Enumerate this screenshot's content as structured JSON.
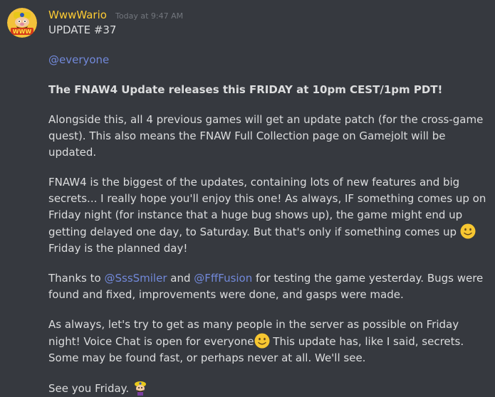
{
  "message": {
    "author": "WwwWario",
    "timestamp": "Today at 9:47 AM",
    "title": "UPDATE #37",
    "mention_everyone": "@everyone",
    "headline": "The FNAW4 Update releases this FRIDAY at 10pm CEST/1pm PDT!",
    "para1": "Alongside this, all 4 previous games will get an update patch (for the cross-game quest). This also means the FNAW Full Collection page on Gamejolt will be updated.",
    "para2_a": "FNAW4 is the biggest of the updates, containing lots of new features and big secrets... I really hope you'll enjoy this one! As always, IF something comes up on Friday night (for instance that a huge bug shows up), the game might end up getting delayed one day, to Saturday. But that's only if something comes up",
    "para2_b": "Friday is the planned day!",
    "para3_a": "Thanks to",
    "mention_1": "@SssSmiler",
    "para3_b": "and",
    "mention_2": "@FffFusion",
    "para3_c": "for testing the game yesterday. Bugs were found and fixed, improvements were done, and gasps were made.",
    "para4_a": "As always, let's try to get as many people in the server as possible on Friday night! Voice Chat is open for everyone",
    "para4_b": "This update has, like I said, secrets. Some may be found fast, or perhaps never at all. We'll see.",
    "closing": "See you Friday.",
    "emojis": [
      "slightly-smiling-face-icon",
      "slightly-smiling-face-icon",
      "wario-emoji-icon"
    ],
    "avatar_text": "WWW"
  },
  "colors": {
    "background": "#36393f",
    "username": "#ffcc33",
    "mention": "#7289da",
    "text": "#dcddde",
    "timestamp": "#72767d"
  }
}
